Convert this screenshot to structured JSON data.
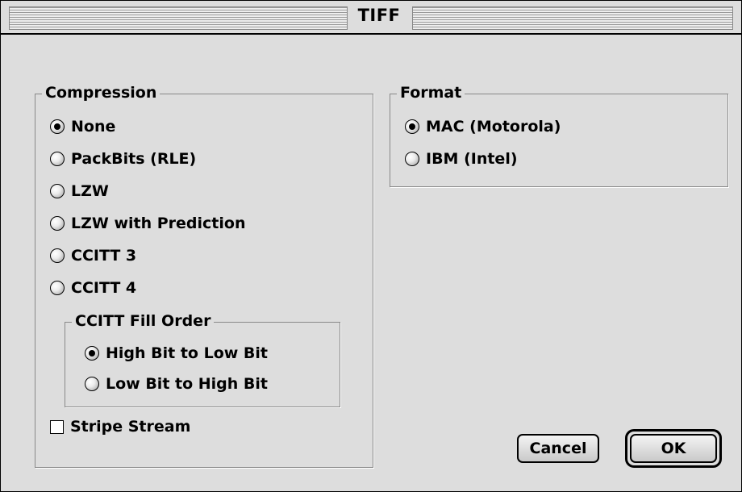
{
  "window": {
    "title": "TIFF"
  },
  "compression": {
    "label": "Compression",
    "options": [
      {
        "label": "None",
        "checked": true
      },
      {
        "label": "PackBits (RLE)",
        "checked": false
      },
      {
        "label": "LZW",
        "checked": false
      },
      {
        "label": "LZW with Prediction",
        "checked": false
      },
      {
        "label": "CCITT 3",
        "checked": false
      },
      {
        "label": "CCITT 4",
        "checked": false
      }
    ],
    "fill_order": {
      "label": "CCITT Fill Order",
      "options": [
        {
          "label": "High Bit to Low Bit",
          "checked": true
        },
        {
          "label": "Low Bit to High Bit",
          "checked": false
        }
      ]
    },
    "stripe_stream": {
      "label": "Stripe Stream",
      "checked": false
    }
  },
  "format": {
    "label": "Format",
    "options": [
      {
        "label": "MAC (Motorola)",
        "checked": true
      },
      {
        "label": "IBM (Intel)",
        "checked": false
      }
    ]
  },
  "buttons": {
    "cancel": "Cancel",
    "ok": "OK",
    "default": "ok"
  }
}
